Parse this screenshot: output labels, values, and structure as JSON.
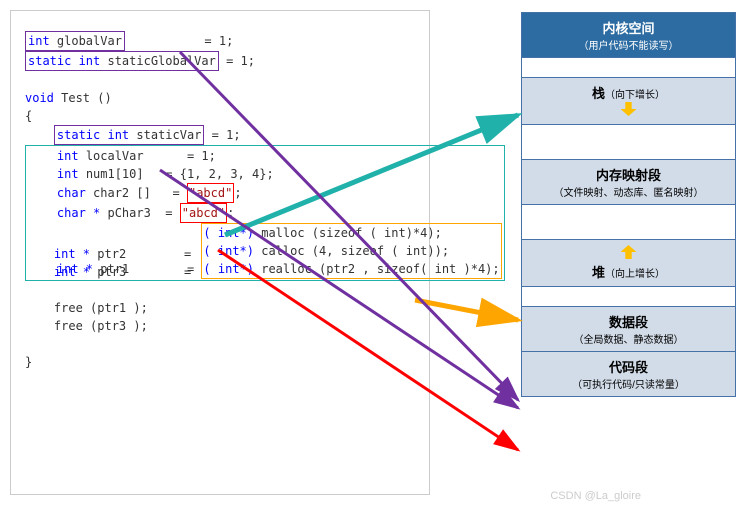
{
  "code": {
    "l1_kw1": "int ",
    "l1_var": "globalVar",
    "l1_pad": "           ",
    "l1_rest": "= 1;",
    "l2_kw1": "static int ",
    "l2_var": "staticGlobalVar",
    "l2_rest": " = 1;",
    "l3_blank": " ",
    "l4_kw": "void ",
    "l4_fn": "Test",
    "l4_rest": " ()",
    "l5": "{",
    "l6_pad": "    ",
    "l6_kw": "static int ",
    "l6_var": "staticVar",
    "l6_rest": " = 1;",
    "l7_pad": "    ",
    "l7_kw": "int ",
    "l7_var": "localVar",
    "l7_pad2": "      ",
    "l7_rest": "= 1;",
    "l8_pad": "    ",
    "l8_kw": "int ",
    "l8_var": "num1[10]",
    "l8_pad2": "   ",
    "l8_rest": "= {1, 2, 3, 4};",
    "l9_pad": "    ",
    "l9_kw": "char ",
    "l9_var": "char2 []",
    "l9_pad2": "   ",
    "l9_eq": "= ",
    "l9_str": "\"abcd\"",
    "l9_semi": ";",
    "l10_pad": "    ",
    "l10_kw": "char * ",
    "l10_var": "pChar3",
    "l10_pad2": "  ",
    "l10_eq": "= ",
    "l10_str": "\"abcd\"",
    "l10_semi": ";",
    "l11_pad": "    ",
    "l11_kw": "int * ",
    "l11_var": "ptr1",
    "l11_pad2": "        ",
    "l11_eq": "= ",
    "l11_cast": "( int*) ",
    "l11_fn": "malloc ",
    "l11_arg": "(sizeof ( int)*4);",
    "l12_pad": "    ",
    "l12_kw": "int * ",
    "l12_var": "ptr2",
    "l12_pad2": "        ",
    "l12_eq": "= ",
    "l12_cast": "( int*) ",
    "l12_fn": "calloc ",
    "l12_arg": "(4, sizeof ( int));",
    "l13_pad": "    ",
    "l13_kw": "int * ",
    "l13_var": "ptr3",
    "l13_pad2": "        ",
    "l13_eq": "= ",
    "l13_cast": "( int*) ",
    "l13_fn": "realloc ",
    "l13_arg": "(ptr2 , sizeof( int )*4);",
    "l14_blank": " ",
    "l15_pad": "    ",
    "l15_fn": "free ",
    "l15_arg": "(ptr1 );",
    "l16_pad": "    ",
    "l16_fn": "free ",
    "l16_arg": "(ptr3 );",
    "l17_blank": " ",
    "l18": "}",
    "l19_blank": " "
  },
  "mem": {
    "kernel_title": "内核空间",
    "kernel_sub": "（用户代码不能读写）",
    "stack_title": "栈",
    "stack_sub": "（向下增长）",
    "mmap_title": "内存映射段",
    "mmap_sub": "（文件映射、动态库、匿名映射）",
    "heap_title": "堆",
    "heap_sub": "（向上增长）",
    "data_title": "数据段",
    "data_sub": "（全局数据、静态数据）",
    "code_title": "代码段",
    "code_sub": "（可执行代码/只读常量）"
  },
  "watermark": "CSDN @La_gloire"
}
